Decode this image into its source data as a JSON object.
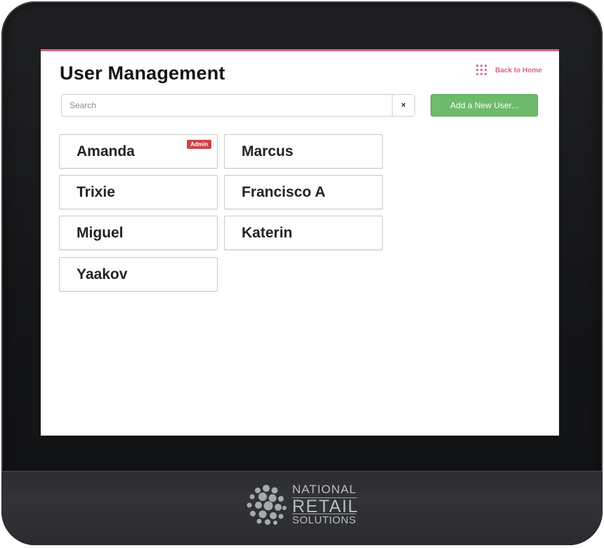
{
  "header": {
    "title": "User Management",
    "back_home_label": "Back to Home",
    "back_home_icon": "grid-icon"
  },
  "search": {
    "placeholder": "Search",
    "value": "",
    "clear_label": "×"
  },
  "actions": {
    "add_user_label": "Add a New User..."
  },
  "users": [
    {
      "name": "Amanda",
      "badge": "Admin"
    },
    {
      "name": "Marcus"
    },
    {
      "name": "Trixie"
    },
    {
      "name": "Francisco A"
    },
    {
      "name": "Miguel"
    },
    {
      "name": "Katerin"
    },
    {
      "name": "Yaakov"
    }
  ],
  "device": {
    "brand_line_1": "NATIONAL",
    "brand_line_2": "RETAIL",
    "brand_line_3": "SOLUTIONS"
  },
  "colors": {
    "accent": "#d9648f",
    "primary_button": "#6dbb6b",
    "admin_badge": "#c9474a"
  }
}
